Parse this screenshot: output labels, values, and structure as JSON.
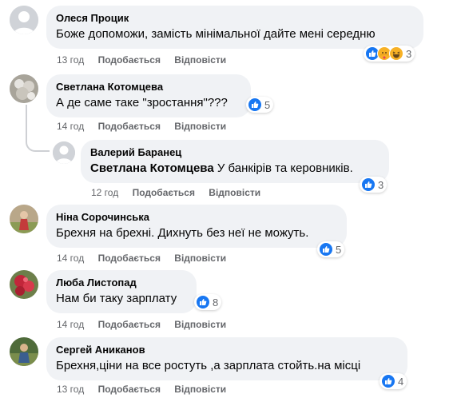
{
  "labels": {
    "like": "Подобається",
    "reply": "Відповісти"
  },
  "comments": [
    {
      "author": "Олеся Процик",
      "text": "Боже допоможи, замість мінімальної дайте мені середню",
      "time": "13 год",
      "reaction_count": "3",
      "reaction_icons": [
        "like-icon",
        "care-icon",
        "haha-icon"
      ]
    },
    {
      "author": "Светлана Котомцева",
      "text": "А де саме таке \"зростання\"???",
      "time": "14 год",
      "reaction_count": "5",
      "reaction_icons": [
        "like-icon"
      ]
    },
    {
      "author": "Валерий Баранец",
      "mention": "Светлана Котомцева",
      "text": "У банкірів та керовників.",
      "time": "12 год",
      "reaction_count": "3",
      "reaction_icons": [
        "like-icon"
      ]
    },
    {
      "author": "Ніна Сорочинська",
      "text": "Брехня на брехні. Дихнуть без неї не можуть.",
      "time": "14 год",
      "reaction_count": "5",
      "reaction_icons": [
        "like-icon"
      ]
    },
    {
      "author": "Люба Листопад",
      "text": "Нам би таку зарплату",
      "time": "14 год",
      "reaction_count": "8",
      "reaction_icons": [
        "like-icon"
      ]
    },
    {
      "author": "Сергей Аниканов",
      "text": "Брехня,ціни на все ростуть ,а зарплата стойть.на місці",
      "time": "13 год",
      "reaction_count": "4",
      "reaction_icons": [
        "like-icon"
      ]
    }
  ],
  "colors": {
    "bubble": "#f0f2f5",
    "meta": "#65676b",
    "like": "#1877f2",
    "emoji": "#f7b125"
  }
}
